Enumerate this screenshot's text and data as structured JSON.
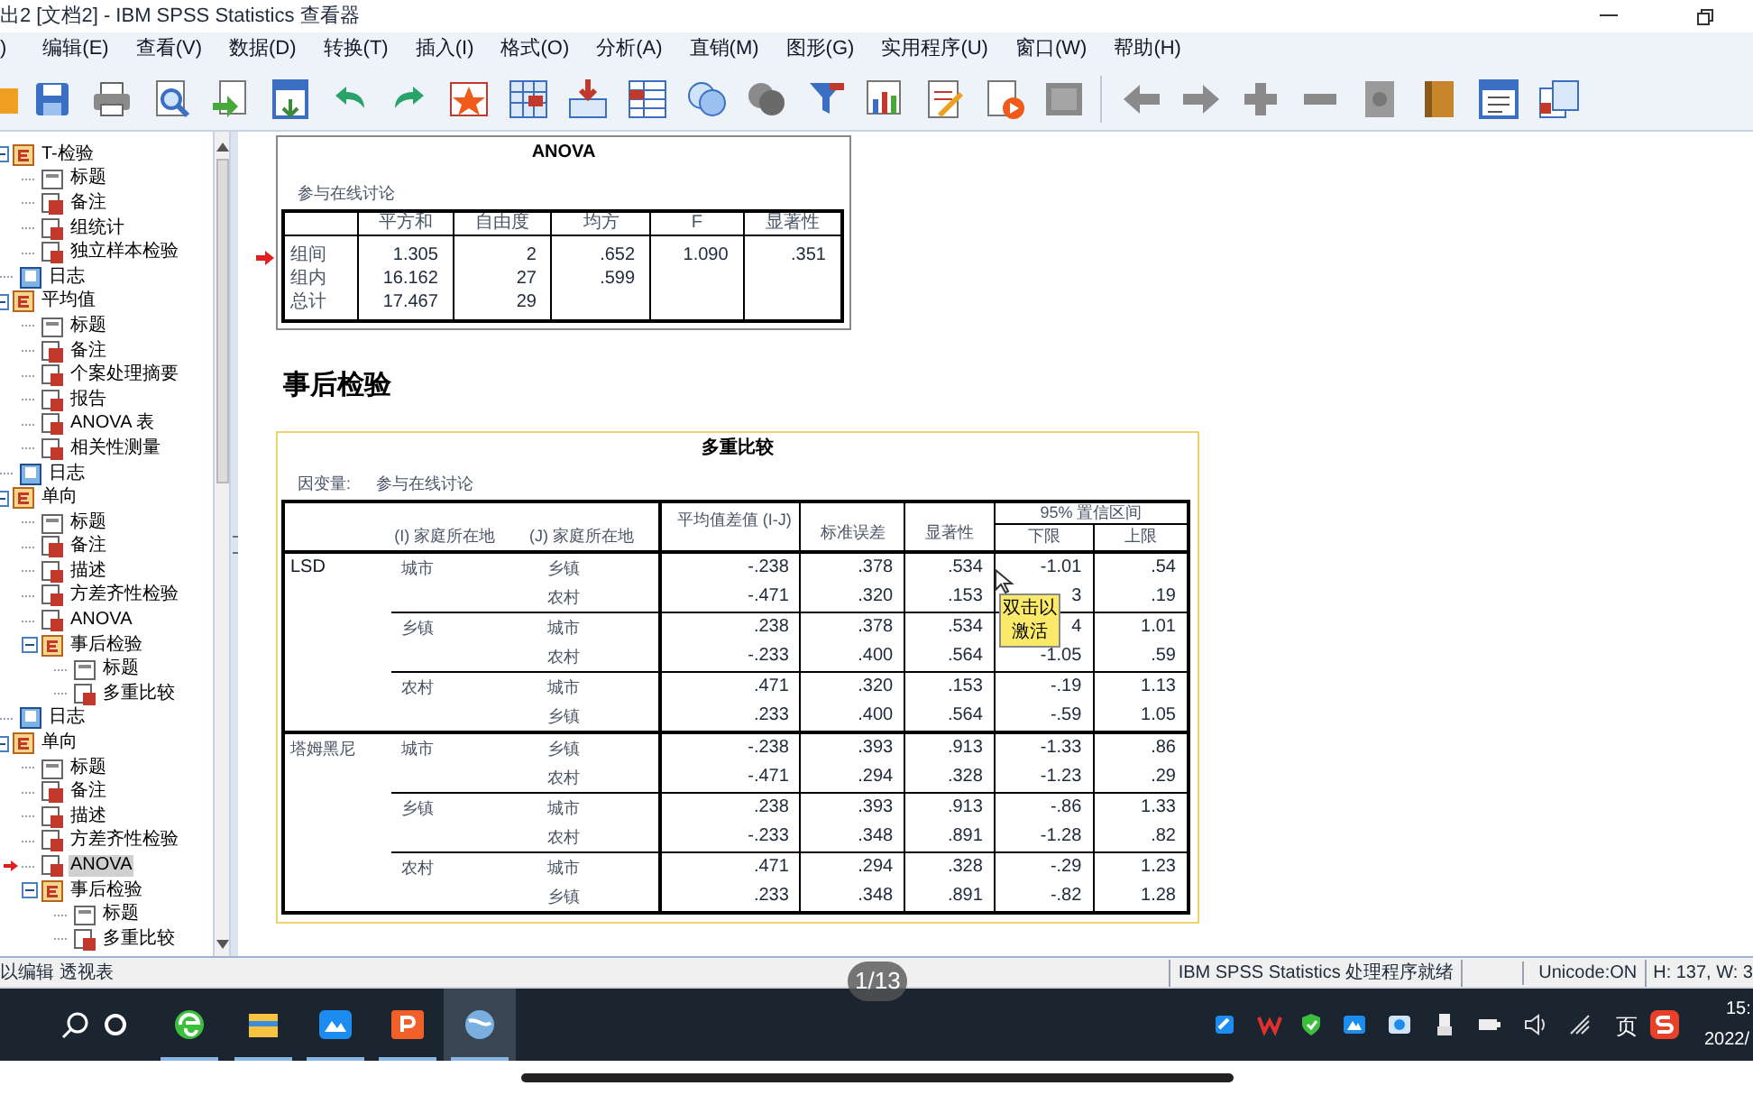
{
  "window": {
    "title": "出2 [文档2] - IBM SPSS Statistics 查看器"
  },
  "menu": [
    ")",
    "编辑(E)",
    "查看(V)",
    "数据(D)",
    "转换(T)",
    "插入(I)",
    "格式(O)",
    "分析(A)",
    "直销(M)",
    "图形(G)",
    "实用程序(U)",
    "窗口(W)",
    "帮助(H)"
  ],
  "outline": [
    {
      "label": "T-检验",
      "kind": "heading",
      "expanded": true,
      "selected": false,
      "children": [
        {
          "label": "标题",
          "kind": "title",
          "selected": false
        },
        {
          "label": "备注",
          "kind": "notes",
          "selected": false
        },
        {
          "label": "组统计",
          "kind": "table",
          "selected": false
        },
        {
          "label": "独立样本检验",
          "kind": "table",
          "selected": false
        }
      ]
    },
    {
      "label": "日志",
      "kind": "log",
      "selected": false
    },
    {
      "label": "平均值",
      "kind": "heading",
      "expanded": true,
      "selected": false,
      "children": [
        {
          "label": "标题",
          "kind": "title",
          "selected": false
        },
        {
          "label": "备注",
          "kind": "notes",
          "selected": false
        },
        {
          "label": "个案处理摘要",
          "kind": "table",
          "selected": false
        },
        {
          "label": "报告",
          "kind": "table",
          "selected": false
        },
        {
          "label": "ANOVA 表",
          "kind": "table",
          "selected": false
        },
        {
          "label": "相关性测量",
          "kind": "table",
          "selected": false
        }
      ]
    },
    {
      "label": "日志",
      "kind": "log",
      "selected": false
    },
    {
      "label": "单向",
      "kind": "heading",
      "expanded": true,
      "selected": false,
      "children": [
        {
          "label": "标题",
          "kind": "title",
          "selected": false
        },
        {
          "label": "备注",
          "kind": "notes",
          "selected": false
        },
        {
          "label": "描述",
          "kind": "table",
          "selected": false
        },
        {
          "label": "方差齐性检验",
          "kind": "table",
          "selected": false
        },
        {
          "label": "ANOVA",
          "kind": "table",
          "selected": false
        },
        {
          "label": "事后检验",
          "kind": "heading",
          "expanded": true,
          "selected": false,
          "children": [
            {
              "label": "标题",
              "kind": "title",
              "selected": false
            },
            {
              "label": "多重比较",
              "kind": "table",
              "selected": false
            }
          ]
        }
      ]
    },
    {
      "label": "日志",
      "kind": "log",
      "selected": false
    },
    {
      "label": "单向",
      "kind": "heading",
      "expanded": true,
      "selected": false,
      "children": [
        {
          "label": "标题",
          "kind": "title",
          "selected": false
        },
        {
          "label": "备注",
          "kind": "notes",
          "selected": false
        },
        {
          "label": "描述",
          "kind": "table",
          "selected": false
        },
        {
          "label": "方差齐性检验",
          "kind": "table",
          "selected": false
        },
        {
          "label": "ANOVA",
          "kind": "table",
          "selected": true
        },
        {
          "label": "事后检验",
          "kind": "heading",
          "expanded": true,
          "selected": false,
          "children": [
            {
              "label": "标题",
              "kind": "title",
              "selected": false
            },
            {
              "label": "多重比较",
              "kind": "table",
              "selected": false
            }
          ]
        }
      ]
    }
  ],
  "anova": {
    "title": "ANOVA",
    "subtitle": "参与在线讨论",
    "columns": [
      "平方和",
      "自由度",
      "均方",
      "F",
      "显著性"
    ],
    "rows": [
      {
        "label": "组间",
        "cells": [
          "1.305",
          "2",
          ".652",
          "1.090",
          ".351"
        ]
      },
      {
        "label": "组内",
        "cells": [
          "16.162",
          "27",
          ".599",
          "",
          ""
        ]
      },
      {
        "label": "总计",
        "cells": [
          "17.467",
          "29",
          "",
          "",
          ""
        ]
      }
    ]
  },
  "section_heading": "事后检验",
  "multiple_comparisons": {
    "title": "多重比较",
    "dependent_label": "因变量:",
    "dependent": "参与在线讨论",
    "columns": {
      "i": "(I) 家庭所在地",
      "j": "(J) 家庭所在地",
      "mean_diff": "平均值差值 (I-J)",
      "std_error": "标准误差",
      "sig": "显著性",
      "ci": "95% 置信区间",
      "lower": "下限",
      "upper": "上限"
    },
    "methods": [
      {
        "name": "LSD",
        "groups": [
          {
            "i": "城市",
            "rows": [
              [
                "乡镇",
                "-.238",
                ".378",
                ".534",
                "-1.01",
                ".54"
              ],
              [
                "农村",
                "-.471",
                ".320",
                ".153",
                "3",
                ".19"
              ]
            ]
          },
          {
            "i": "乡镇",
            "rows": [
              [
                "城市",
                ".238",
                ".378",
                ".534",
                "4",
                "1.01"
              ],
              [
                "农村",
                "-.233",
                ".400",
                ".564",
                "-1.05",
                ".59"
              ]
            ]
          },
          {
            "i": "农村",
            "rows": [
              [
                "城市",
                ".471",
                ".320",
                ".153",
                "-.19",
                "1.13"
              ],
              [
                "乡镇",
                ".233",
                ".400",
                ".564",
                "-.59",
                "1.05"
              ]
            ]
          }
        ]
      },
      {
        "name": "塔姆黑尼",
        "groups": [
          {
            "i": "城市",
            "rows": [
              [
                "乡镇",
                "-.238",
                ".393",
                ".913",
                "-1.33",
                ".86"
              ],
              [
                "农村",
                "-.471",
                ".294",
                ".328",
                "-1.23",
                ".29"
              ]
            ]
          },
          {
            "i": "乡镇",
            "rows": [
              [
                "城市",
                ".238",
                ".393",
                ".913",
                "-.86",
                "1.33"
              ],
              [
                "农村",
                "-.233",
                ".348",
                ".891",
                "-1.28",
                ".82"
              ]
            ]
          },
          {
            "i": "农村",
            "rows": [
              [
                "城市",
                ".471",
                ".294",
                ".328",
                "-.29",
                "1.23"
              ],
              [
                "乡镇",
                ".233",
                ".348",
                ".891",
                "-.82",
                "1.28"
              ]
            ]
          }
        ]
      }
    ],
    "tooltip": "双击以激活"
  },
  "status_bar": {
    "hint": "以编辑 透视表",
    "processor": "IBM SPSS Statistics 处理程序就绪",
    "unicode": "Unicode:ON",
    "size": "H: 137, W: 3"
  },
  "video_page_counter": "1/13",
  "taskbar": {
    "ime": "页",
    "time": "15:",
    "date": "2022/"
  }
}
